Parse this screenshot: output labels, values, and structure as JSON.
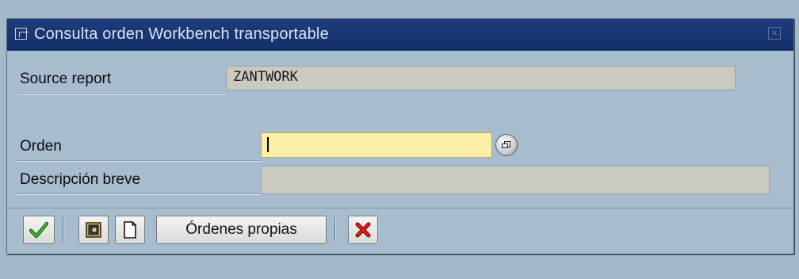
{
  "window": {
    "title": "Consulta orden Workbench transportable",
    "title_icon": "window-icon",
    "close_icon": "close-icon"
  },
  "form": {
    "source_report": {
      "label": "Source report",
      "value": "ZANTWORK"
    },
    "orden": {
      "label": "Orden",
      "value": "",
      "help_icon": "f4-value-help-icon"
    },
    "descripcion": {
      "label": "Descripción breve",
      "value": ""
    }
  },
  "toolbar": {
    "continue_icon": "checkmark-icon",
    "other_icon": "frame-icon",
    "create_icon": "new-document-icon",
    "own_orders_label": "Órdenes propias",
    "cancel_icon": "red-x-icon"
  },
  "colors": {
    "title_bar": "#14306b",
    "background": "#a7bdcf",
    "input_required": "#fdeea5",
    "readonly_field": "#cccac0"
  }
}
